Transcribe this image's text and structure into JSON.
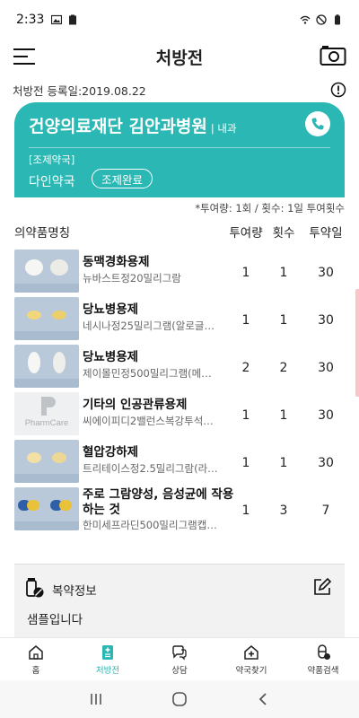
{
  "status_bar": {
    "time": "2:33"
  },
  "header": {
    "title": "처방전"
  },
  "registration": {
    "label": "처방전 등록일:2019.08.22"
  },
  "hospital": {
    "name": "건양의료재단 김안과병원",
    "department": "| 내과",
    "pharmacy_label": "[조제약국]",
    "pharmacy_name": "다인약국",
    "status": "조제완료"
  },
  "dose_note": "*투여량: 1회 / 횟수: 1일 투여횟수",
  "table": {
    "headers": {
      "name": "의약품명칭",
      "dose": "투여량",
      "times": "횟수",
      "days": "투약일"
    },
    "rows": [
      {
        "category": "동맥경화용제",
        "product": "뉴바스트정20밀리그람",
        "dose": "1",
        "times": "1",
        "days": "30",
        "pill": "white-round"
      },
      {
        "category": "당뇨병용제",
        "product": "네시나정25밀리그램(알로글…",
        "dose": "1",
        "times": "1",
        "days": "30",
        "pill": "yellow-oval"
      },
      {
        "category": "당뇨병용제",
        "product": "제이몰민정500밀리그램(메…",
        "dose": "2",
        "times": "2",
        "days": "30",
        "pill": "white-oval"
      },
      {
        "category": "기타의 인공관류용제",
        "product": "씨에이피디2밸런스복강투석…",
        "dose": "1",
        "times": "1",
        "days": "30",
        "pill": "pharmcare"
      },
      {
        "category": "혈압강하제",
        "product": "트리테이스정2.5밀리그람(라…",
        "dose": "1",
        "times": "1",
        "days": "30",
        "pill": "yellow-round"
      },
      {
        "category": "주로 그람양성, 음성균에 작용하는 것",
        "product": "한미세프라딘500밀리그램캡…",
        "dose": "1",
        "times": "3",
        "days": "7",
        "pill": "capsule"
      }
    ]
  },
  "thumb_texts": {
    "pharmcare": "PharmCare"
  },
  "med_info": {
    "title": "복약정보",
    "text": "샘플입니다"
  },
  "bottom_nav": [
    {
      "label": "홈",
      "icon": "home-icon"
    },
    {
      "label": "처방전",
      "icon": "prescription-icon"
    },
    {
      "label": "상담",
      "icon": "chat-icon"
    },
    {
      "label": "약국찾기",
      "icon": "pharmacy-icon"
    },
    {
      "label": "약품검색",
      "icon": "pill-search-icon"
    }
  ],
  "colors": {
    "accent": "#2bb7b3",
    "card_bg": "#2bb7b3"
  }
}
